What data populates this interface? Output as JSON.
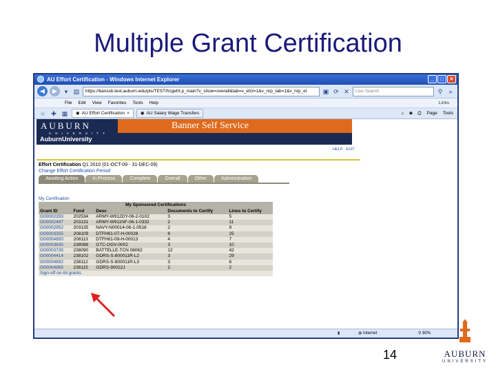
{
  "slide": {
    "title": "Multiple Grant Certification",
    "page_number": "14",
    "logo_text": "AUBURN",
    "logo_sub": "UNIVERSITY"
  },
  "browser": {
    "window_title": "AU Effort Certification - Windows Internet Explorer",
    "url": "https://banssb.test.auburn.edu/pls/TEST/hzgefrt.p_main?v_show=overall&tab=v_efct=1&v_nrp_tab=1&v_nrp_el",
    "search_placeholder": "Live Search",
    "menu": [
      "File",
      "Edit",
      "View",
      "Favorites",
      "Tools",
      "Help"
    ],
    "links_label": "Links",
    "tabs": [
      "AU Effort Certification",
      "AU Salary Wage Transfers"
    ],
    "tab_tools": [
      "Page",
      "Tools"
    ],
    "status": {
      "internet": "Internet",
      "zoom": "80%"
    }
  },
  "app": {
    "banner_title": "Banner Self Service",
    "banner_logo": "AUBURN",
    "banner_logo_sub": "UNIVERSITY",
    "university": "AuburnUniversity",
    "help": "HELP",
    "exit": "EXIT",
    "effort_label": "Effort Certification",
    "effort_period": "Q1 2010 (01-OCT-09 - 31-DEC-09)",
    "change_period": "Change Effort Certification Period",
    "tabs": [
      "Awaiting Action",
      "In Process",
      "Complete",
      "Overall",
      "Other",
      "Administration"
    ],
    "my_certification": "My Certification",
    "table_caption": "My Sponsored Certifications",
    "columns": [
      "Grant ID",
      "Fund",
      "Desc",
      "Documents to Certify",
      "Lines to Certify"
    ],
    "rows": [
      [
        "G00002293",
        "202534",
        "ARMY-W912DY-06-2-0102",
        "3",
        "5"
      ],
      [
        "G00002497",
        "203131",
        "ARMY-W911NF-06-1-0332",
        "2",
        "11"
      ],
      [
        "G00002952",
        "203135",
        "NAVY-N00014-06-1-0518",
        "2",
        "9"
      ],
      [
        "G00003355",
        "208109",
        "DTFH61-07-H-00028",
        "6",
        "25"
      ],
      [
        "G00004850",
        "208113",
        "DTFH61-09-H-00013",
        "4",
        "7"
      ],
      [
        "G00003635",
        "238088",
        "GTC-OGV-0002",
        "3",
        "10"
      ],
      [
        "G00003735",
        "238090",
        "BATTELLE-TCN 08062",
        "12",
        "42"
      ],
      [
        "G00004414",
        "238102",
        "GDRS-S-800011R-L2",
        "3",
        "29"
      ],
      [
        "G00004892",
        "238112",
        "GDRS-S-800011R-L3",
        "3",
        "6"
      ],
      [
        "G00004965",
        "238115",
        "GDRS-90022J",
        "2",
        "2"
      ]
    ],
    "signoff": "Sign-off on All grants"
  },
  "colors": {
    "title": "#1a1a7a",
    "banner_orange": "#e06a1c",
    "banner_navy": "#1b2a52",
    "link_blue": "#1f4fa6",
    "arrow_red": "#e02020"
  }
}
